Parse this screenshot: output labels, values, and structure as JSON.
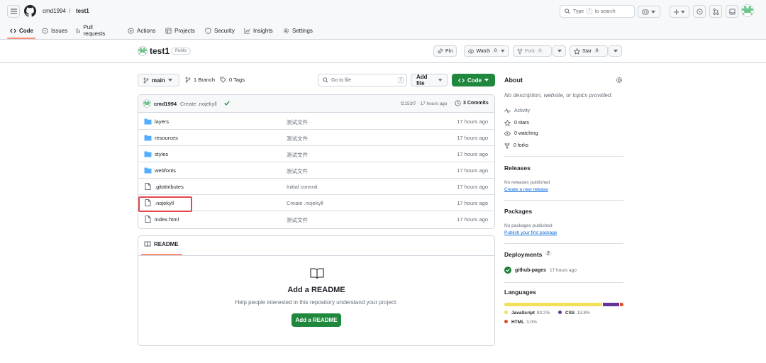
{
  "header": {
    "owner": "cmd1994",
    "slash": "/",
    "repo": "test1",
    "search_placeholder_pre": "Type",
    "search_key": "/",
    "search_placeholder_post": "to search"
  },
  "nav": {
    "tabs": [
      {
        "label": "Code",
        "icon": "code-icon"
      },
      {
        "label": "Issues",
        "icon": "issue-icon"
      },
      {
        "label": "Pull requests",
        "icon": "pull-request-icon"
      },
      {
        "label": "Actions",
        "icon": "play-icon"
      },
      {
        "label": "Projects",
        "icon": "table-icon"
      },
      {
        "label": "Security",
        "icon": "shield-icon"
      },
      {
        "label": "Insights",
        "icon": "graph-icon"
      },
      {
        "label": "Settings",
        "icon": "gear-icon"
      }
    ]
  },
  "repo": {
    "name": "test1",
    "visibility": "Public",
    "pin_label": "Pin",
    "watch_label": "Watch",
    "watch_count": "0",
    "fork_label": "Fork",
    "fork_count": "0",
    "star_label": "Star",
    "star_count": "0"
  },
  "branchbar": {
    "branch": "main",
    "branches": "1 Branch",
    "tags": "0 Tags",
    "goto_placeholder": "Go to file",
    "goto_key": "t",
    "add_file": "Add file",
    "code": "Code"
  },
  "commit": {
    "author": "cmd1994",
    "message": "Create .nojekyll",
    "hash_time": "f2153f7 · 17 hours ago",
    "commits": "3 Commits"
  },
  "files": [
    {
      "name": "layers",
      "type": "dir",
      "message": "测试文件",
      "time": "17 hours ago"
    },
    {
      "name": "resources",
      "type": "dir",
      "message": "测试文件",
      "time": "17 hours ago"
    },
    {
      "name": "styles",
      "type": "dir",
      "message": "测试文件",
      "time": "17 hours ago"
    },
    {
      "name": "webfonts",
      "type": "dir",
      "message": "测试文件",
      "time": "17 hours ago"
    },
    {
      "name": ".gitattributes",
      "type": "file",
      "message": "Initial commit",
      "time": "17 hours ago"
    },
    {
      "name": ".nojekyll",
      "type": "file",
      "message": "Create .nojekyll",
      "time": "17 hours ago"
    },
    {
      "name": "index.html",
      "type": "file",
      "message": "测试文件",
      "time": "17 hours ago"
    }
  ],
  "readme": {
    "tab": "README",
    "title": "Add a README",
    "description": "Help people interested in this repository understand your project.",
    "button": "Add a README"
  },
  "about": {
    "title": "About",
    "description": "No description, website, or topics provided.",
    "activity": "Activity",
    "stars": "0 stars",
    "watching": "0 watching",
    "forks": "0 forks"
  },
  "releases": {
    "title": "Releases",
    "text": "No releases published",
    "link": "Create a new release"
  },
  "packages": {
    "title": "Packages",
    "text": "No packages published",
    "link": "Publish your first package"
  },
  "deployments": {
    "title": "Deployments",
    "count": "2",
    "env": "github-pages",
    "time": "17 hours ago"
  },
  "languages": {
    "title": "Languages",
    "items": [
      {
        "name": "JavaScript",
        "percent": "83.2%",
        "value": 83.2,
        "color": "#f1e05a"
      },
      {
        "name": "CSS",
        "percent": "13.8%",
        "value": 13.8,
        "color": "#663399"
      },
      {
        "name": "HTML",
        "percent": "3.0%",
        "value": 3.0,
        "color": "#e34c26"
      }
    ]
  },
  "colors": {
    "accent_green": "#1f883d",
    "link": "#0969da",
    "highlight_red": "#e5484d"
  }
}
